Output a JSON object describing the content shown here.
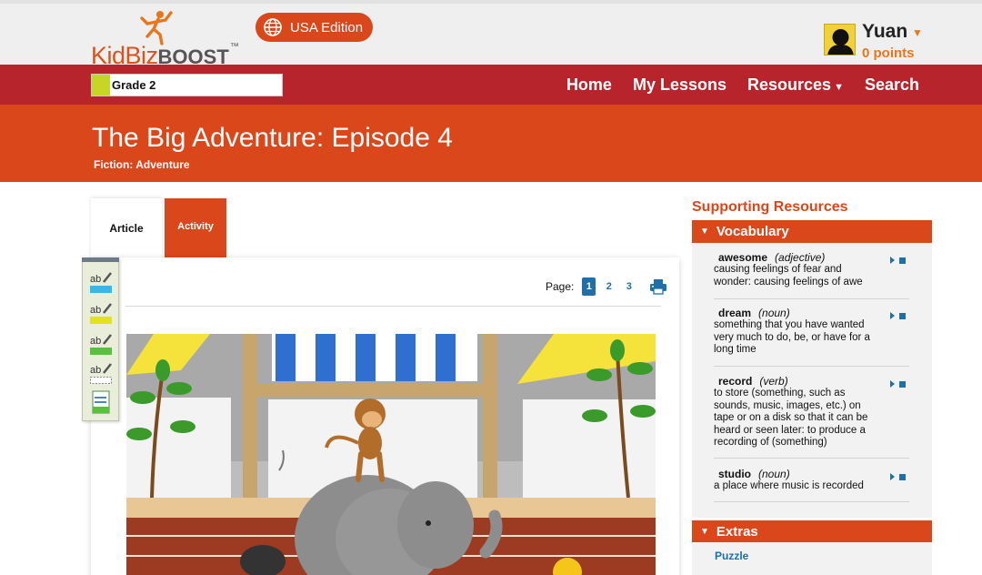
{
  "header": {
    "logo_kid": "KidBiz",
    "logo_boost": "BOOST",
    "logo_tm": "™",
    "edition_label": "USA Edition",
    "user_name": "Yuan",
    "user_points": "0 points"
  },
  "nav": {
    "grade": "Grade 2",
    "items": [
      "Home",
      "My Lessons",
      "Resources",
      "Search"
    ]
  },
  "article": {
    "title": "The Big Adventure: Episode 4",
    "genre": "Fiction: Adventure",
    "tabs": [
      "Article",
      "Activity"
    ],
    "page_label": "Page:",
    "pages": [
      "1",
      "2",
      "3"
    ],
    "current_page": "1"
  },
  "sidebar": {
    "heading": "Supporting Resources",
    "vocabulary_title": "Vocabulary",
    "vocabulary": [
      {
        "word": "awesome",
        "pos": "(adjective)",
        "definition": "causing feelings of fear and wonder: causing feelings of awe"
      },
      {
        "word": "dream",
        "pos": "(noun)",
        "definition": "something that you have wanted very much to do, be, or have for a long time"
      },
      {
        "word": "record",
        "pos": "(verb)",
        "definition": "to store (something, such as sounds, music, images, etc.) on tape or on a disk so that it can be heard or seen later: to produce a recording of (something)"
      },
      {
        "word": "studio",
        "pos": "(noun)",
        "definition": "a place where music is recorded"
      }
    ],
    "extras_title": "Extras",
    "extras_items": [
      "Puzzle"
    ]
  },
  "colors": {
    "brand_orange": "#d9471b",
    "nav_red": "#b7242b",
    "link_blue": "#1f6fa8",
    "grade_swatch": "#c6d624"
  },
  "icons": {
    "edition": "globe-icon",
    "print": "printer-icon",
    "tools": [
      "highlight-blue-icon",
      "highlight-yellow-icon",
      "highlight-green-icon",
      "erase-highlight-icon",
      "notes-icon"
    ]
  }
}
